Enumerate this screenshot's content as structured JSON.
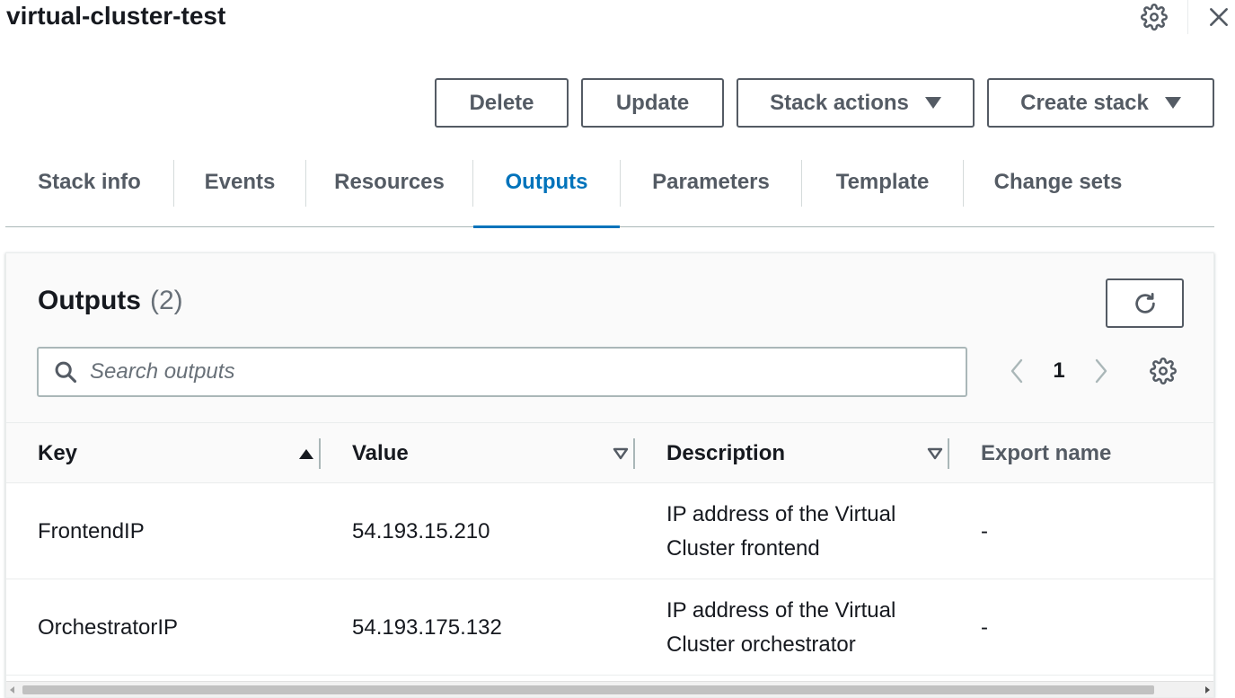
{
  "page": {
    "title": "virtual-cluster-test",
    "icons": {
      "settings": "gear-icon",
      "close": "close-icon"
    }
  },
  "actions": {
    "delete_label": "Delete",
    "update_label": "Update",
    "stack_actions_label": "Stack actions",
    "create_stack_label": "Create stack"
  },
  "tabs": [
    {
      "label": "Stack info",
      "active": false
    },
    {
      "label": "Events",
      "active": false
    },
    {
      "label": "Resources",
      "active": false
    },
    {
      "label": "Outputs",
      "active": true
    },
    {
      "label": "Parameters",
      "active": false
    },
    {
      "label": "Template",
      "active": false
    },
    {
      "label": "Change sets",
      "active": false
    }
  ],
  "outputs": {
    "title": "Outputs",
    "count": "(2)",
    "search_placeholder": "Search outputs",
    "search_value": "",
    "page_number": "1",
    "columns": {
      "key": "Key",
      "value": "Value",
      "description": "Description",
      "export_name": "Export name"
    },
    "sort": {
      "column": "key",
      "direction": "ascending"
    },
    "rows": [
      {
        "key": "FrontendIP",
        "value": "54.193.15.210",
        "description": "IP address of the Virtual Cluster frontend",
        "export_name": "-"
      },
      {
        "key": "OrchestratorIP",
        "value": "54.193.175.132",
        "description": "IP address of the Virtual Cluster orchestrator",
        "export_name": "-"
      }
    ]
  },
  "colors": {
    "accent": "#0073bb",
    "text": "#16191f",
    "muted": "#545b64",
    "border": "#aab7b8"
  }
}
